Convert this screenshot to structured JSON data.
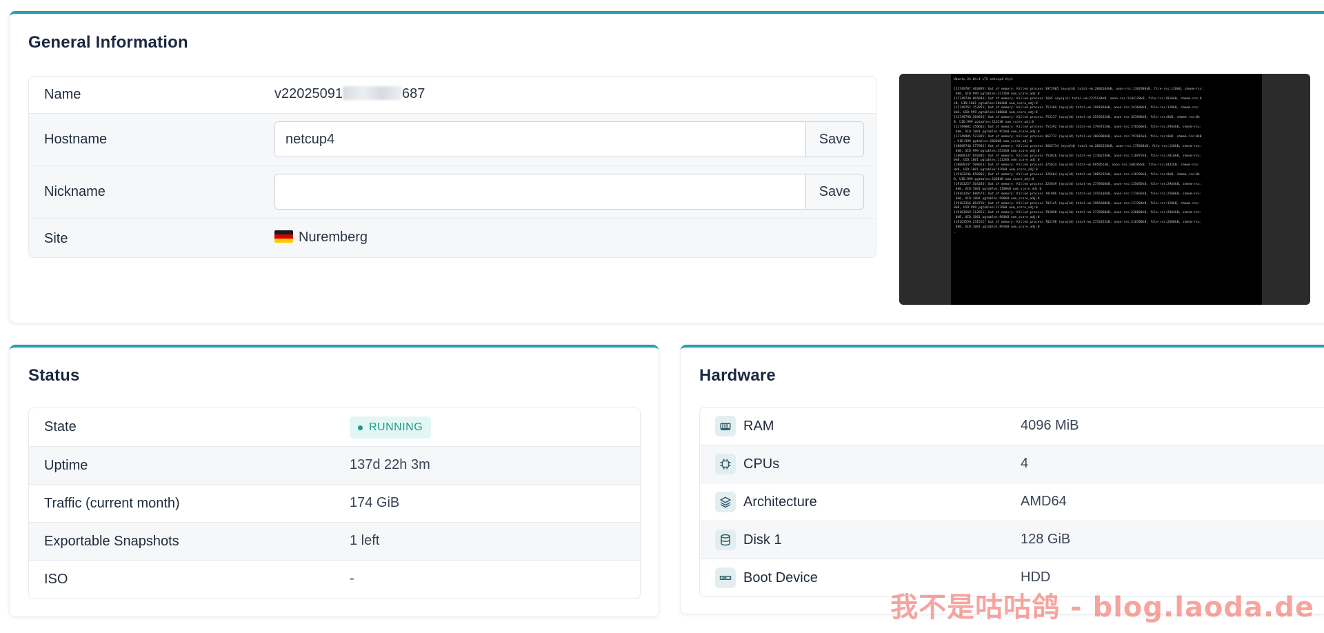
{
  "general": {
    "title": "General Information",
    "name_label": "Name",
    "name_value_prefix": "v22025091",
    "name_value_suffix": "687",
    "hostname_label": "Hostname",
    "hostname_value": "netcup4",
    "nickname_label": "Nickname",
    "nickname_value": "",
    "save_label": "Save",
    "site_label": "Site",
    "site_value": "Nuremberg",
    "site_flag": "germany-flag"
  },
  "console": {
    "lines": [
      "Ubuntu 24.04.4 LTS netcup4 tty1",
      "",
      "[12749707.403895] Out of memory: Killed process 3972905 (mysqld) total-vm:2803104kB, anon-rss:1382908kB, file-rss:128kB, shmem-rss:",
      " 0kB, UID:999 pgtables:3272kB oom_score_adj:0",
      "[12749740.065043] Out of memory: Killed process 1665 (mysqld) total-vm:2235144kB, anon-rss:1144128kB, file-rss:2816kB, shmem-rss:0",
      "kB, UID:1001 pgtables:1664kB oom_score_adj:0",
      "[12749762.153951] Out of memory: Killed process 752369 (mysqld) total-vm:1991864kB, anon-rss:243648kB, file-rss:128kB, shmem-rss:",
      "0kB, UID:999 pgtables:1080kB oom_score_adj:0",
      "[12749798.304925] Out of memory: Killed process 753137 (mysqld) total-vm:2593532kB, anon-rss:353948kB, file-rss:0kB, shmem-rss:0k",
      "B, UID:999 pgtables:1132kB oom_score_adj:0",
      "[12749882.356681] Out of memory: Killed process 752392 (mysqld) total-vm:2793712kB, anon-rss:270160kB, file-rss:2944kB, shmem-rss:",
      " 0kB, UID:1001 pgtables:952kB oom_score_adj:0",
      "[12749905.523385] Out of memory: Killed process 862722 (mysqld) total-vm:2803088kB, anon-rss:797016kB, file-rss:0kB, shmem-rss:0kB",
      ", UID:999 pgtables:1820kB oom_score_adj:0",
      "[18009746.577982] Out of memory: Killed process 3665734 (mysqld) total-vm:2862320kB, anon-rss:179248kB, file-rss:128kB, shmem-rss:",
      " 0kB, UID:999 pgtables:1532kB oom_score_adj:0",
      "[18009137.692891] Out of memory: Killed process 753026 (mysqld) total-vm:2736224kB, anon-rss:116972kB, file-rss:2816kB, shmem-rss:",
      "0kB, UID:1001 pgtables:1112kB oom_score_adj:0",
      "[18009147.509023] Out of memory: Killed process 325624 (mysqld) total-vm:695052kB, anon-rss:160192kB, file-rss:2432kB, shmem-rss:",
      "0kB, UID:1001 pgtables:476kB oom_score_adj:0",
      "[19163246.650981] Out of memory: Killed process 325664 (mysqld) total-vm:2805232kB, anon-rss:130396kB, file-rss:0kB, shmem-rss:0k",
      "B, UID:999 pgtables:1268kB oom_score_adj:0",
      "[19163257.564283] Out of memory: Killed process 325649 (mysqld) total-vm:2739368kB, anon-rss:135692kB, file-rss:2944kB, shmem-rss:",
      " 0kB, UID:1001 pgtables:1108kB oom_score_adj:0",
      "[19163262.880573] Out of memory: Killed process 701986 (mysqld) total-vm:2416104kB, anon-rss:173032kB, file-rss:2560kB, shmem-rss:",
      " 0kB, UID:1001 pgtables:580kB oom_score_adj:0",
      "[19163356.664756] Out of memory: Killed process 702145 (mysqld) total-vm:2965600kB, anon-rss:121704kB, file-rss:128kB, shmem-rss:",
      "0kB, UID:999 pgtables:1176kB oom_score_adj:0",
      "[19163569.312651] Out of memory: Killed process 702098 (mysqld) total-vm:2735860kB, anon-rss:226004kB, file-rss:2944kB, shmem-rss:",
      " 0kB, UID:1001 pgtables:964kB oom_score_adj:0",
      "[19163559.231522] Out of memory: Killed process 702198 (mysqld) total-vm:2732452kB, anon-rss:216700kB, file-rss:2688kB, shmem-rss:",
      " 0kB, UID:1001 pgtables:892kB oom_score_adj:0",
      "_"
    ]
  },
  "status": {
    "title": "Status",
    "rows": [
      {
        "label": "State",
        "value": "RUNNING"
      },
      {
        "label": "Uptime",
        "value": "137d 22h 3m"
      },
      {
        "label": "Traffic (current month)",
        "value": "174 GiB"
      },
      {
        "label": "Exportable Snapshots",
        "value": "1 left"
      },
      {
        "label": "ISO",
        "value": "-"
      }
    ]
  },
  "hardware": {
    "title": "Hardware",
    "rows": [
      {
        "label": "RAM",
        "value": "4096 MiB",
        "icon": "memory-icon"
      },
      {
        "label": "CPUs",
        "value": "4",
        "icon": "cpu-icon"
      },
      {
        "label": "Architecture",
        "value": "AMD64",
        "icon": "layers-icon"
      },
      {
        "label": "Disk 1",
        "value": "128 GiB",
        "icon": "database-icon"
      },
      {
        "label": "Boot Device",
        "value": "HDD",
        "icon": "drive-icon"
      }
    ]
  },
  "watermark": "我不是咕咕鸽 - blog.laoda.de",
  "colors": {
    "accent": "#21a2b3",
    "running_badge_bg": "#e3f6f4",
    "running_badge_text": "#1a9a8a"
  }
}
